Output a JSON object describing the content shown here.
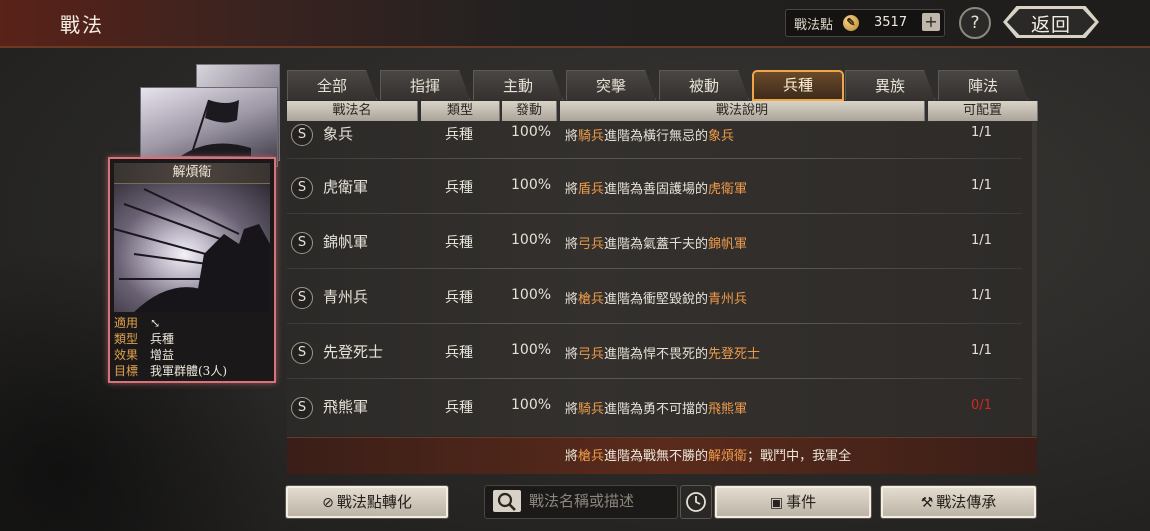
{
  "header": {
    "title": "戰法",
    "points_label": "戰法點",
    "points_value": "3517",
    "plus_label": "+",
    "help_label": "?",
    "back_label": "返回"
  },
  "card": {
    "title": "解煩衛",
    "fields": [
      {
        "key": "適用",
        "value": ""
      },
      {
        "key": "類型",
        "value": "兵種"
      },
      {
        "key": "效果",
        "value": "增益"
      },
      {
        "key": "目標",
        "value": "我軍群體(3人)"
      }
    ]
  },
  "tabs": [
    {
      "label": "全部",
      "active": false
    },
    {
      "label": "指揮",
      "active": false
    },
    {
      "label": "主動",
      "active": false
    },
    {
      "label": "突擊",
      "active": false
    },
    {
      "label": "被動",
      "active": false
    },
    {
      "label": "兵種",
      "active": true
    },
    {
      "label": "異族",
      "active": false
    },
    {
      "label": "陣法",
      "active": false
    }
  ],
  "columns": [
    "戰法名",
    "類型",
    "發動",
    "戰法說明",
    "可配置"
  ],
  "rows": [
    {
      "badge": "S",
      "name": "象兵",
      "type": "兵種",
      "rate": "100%",
      "d1": "將",
      "d2": "騎兵",
      "d3": "進階為橫行無忌的",
      "d4": "象兵",
      "count": "1/1",
      "count_red": false
    },
    {
      "badge": "S",
      "name": "虎衛軍",
      "type": "兵種",
      "rate": "100%",
      "d1": "將",
      "d2": "盾兵",
      "d3": "進階為善固護場的",
      "d4": "虎衛軍",
      "count": "1/1",
      "count_red": false
    },
    {
      "badge": "S",
      "name": "錦帆軍",
      "type": "兵種",
      "rate": "100%",
      "d1": "將",
      "d2": "弓兵",
      "d3": "進階為氣蓋千夫的",
      "d4": "錦帆軍",
      "count": "1/1",
      "count_red": false
    },
    {
      "badge": "S",
      "name": "青州兵",
      "type": "兵種",
      "rate": "100%",
      "d1": "將",
      "d2": "槍兵",
      "d3": "進階為衝堅毀銳的",
      "d4": "青州兵",
      "count": "1/1",
      "count_red": false
    },
    {
      "badge": "S",
      "name": "先登死士",
      "type": "兵種",
      "rate": "100%",
      "d1": "將",
      "d2": "弓兵",
      "d3": "進階為悍不畏死的",
      "d4": "先登死士",
      "count": "1/1",
      "count_red": false
    },
    {
      "badge": "S",
      "name": "飛熊軍",
      "type": "兵種",
      "rate": "100%",
      "d1": "將",
      "d2": "騎兵",
      "d3": "進階為勇不可擋的",
      "d4": "飛熊軍",
      "count": "0/1",
      "count_red": true
    }
  ],
  "detail": {
    "d1": "將",
    "d2": "槍兵",
    "d3": "進階為戰無不勝的",
    "d4": "解煩衛",
    "d5": "；戰鬥中，我軍全"
  },
  "bottom": {
    "convert_label": "戰法點轉化",
    "search_placeholder": "戰法名稱或描述",
    "events_label": "事件",
    "inherit_label": "戰法傳承"
  },
  "colors": {
    "accent_orange": "#ee9b4a",
    "tab_active_border": "#f0a646",
    "card_border": "#d8737a",
    "count_red": "#d02a22"
  },
  "icons": [
    "coin-icon",
    "plus-icon",
    "help-icon",
    "search-icon",
    "clock-icon",
    "convert-icon",
    "event-icon",
    "hammer-icon"
  ]
}
